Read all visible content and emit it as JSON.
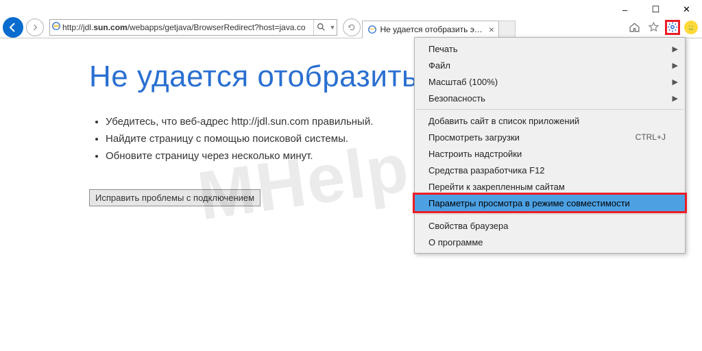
{
  "window": {
    "minimize": "–",
    "maximize": "☐",
    "close": "✕"
  },
  "address": {
    "prefix": "http://jdl.",
    "domain": "sun.com",
    "suffix": "/webapps/getjava/BrowserRedirect?host=java.co"
  },
  "tab": {
    "title": "Не удается отобразить эту..."
  },
  "page": {
    "heading": "Не удается отобразить эту страницу",
    "bullets": [
      "Убедитесь, что веб-адрес http://jdl.sun.com правильный.",
      "Найдите страницу с помощью поисковой системы.",
      "Обновите страницу через несколько минут."
    ],
    "fix_button": "Исправить проблемы с подключением"
  },
  "watermark": "MHelp.kz",
  "menu": {
    "group1": [
      {
        "label": "Печать",
        "submenu": true
      },
      {
        "label": "Файл",
        "submenu": true
      },
      {
        "label": "Масштаб (100%)",
        "submenu": true
      },
      {
        "label": "Безопасность",
        "submenu": true
      }
    ],
    "group2": [
      {
        "label": "Добавить сайт в список приложений"
      },
      {
        "label": "Просмотреть загрузки",
        "shortcut": "CTRL+J"
      },
      {
        "label": "Настроить надстройки"
      },
      {
        "label": "Средства разработчика F12"
      },
      {
        "label": "Перейти к закрепленным сайтам"
      },
      {
        "label": "Параметры просмотра в режиме совместимости",
        "highlight": true
      }
    ],
    "group3": [
      {
        "label": "Свойства браузера"
      },
      {
        "label": "О программе"
      }
    ]
  }
}
